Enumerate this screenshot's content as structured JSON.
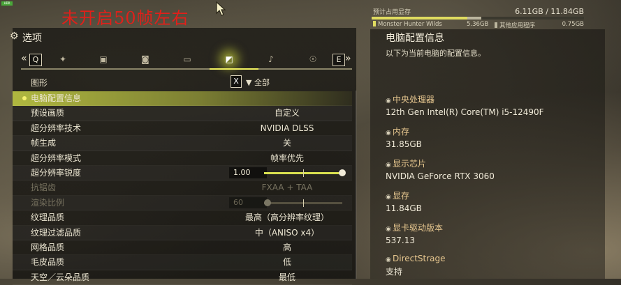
{
  "overlay": {
    "badge": "HDR",
    "note": "未开启50帧左右"
  },
  "vram": {
    "label": "预计占用显存",
    "total": "6.11GB / 11.84GB",
    "used_fraction": 0.452,
    "other_fraction": 0.064,
    "game_name": "Monster Hunter Wilds",
    "game_size": "5.36GB",
    "other_name": "其他应用程序",
    "other_size": "0.75GB",
    "colors": {
      "game": "#e0dc60",
      "other": "#bbb59e"
    }
  },
  "header": {
    "title": "选项",
    "icon": "gear-icon"
  },
  "tabs": {
    "prev_key": "Q",
    "next_key": "E",
    "icons": [
      "hunter-icon",
      "gamepad-icon",
      "camera-icon",
      "display-icon",
      "graphics-icon",
      "sound-icon",
      "accessibility-icon"
    ],
    "active_index": 4
  },
  "section": {
    "label": "图形",
    "filter_key": "X",
    "filter_label": "全部"
  },
  "settings": [
    {
      "name": "电脑配置信息",
      "value": "",
      "selected": true
    },
    {
      "name": "预设画质",
      "value": "自定义"
    },
    {
      "name": "超分辨率技术",
      "value": "NVIDIA DLSS"
    },
    {
      "name": "帧生成",
      "value": "关"
    },
    {
      "name": "超分辨率模式",
      "value": "帧率优先"
    },
    {
      "name": "超分辨率锐度",
      "value": "1.00",
      "slider": 1.0
    },
    {
      "name": "抗锯齿",
      "value": "FXAA + TAA",
      "disabled": true
    },
    {
      "name": "渲染比例",
      "value": "60",
      "slider": 0.0,
      "disabled": true
    },
    {
      "name": "纹理品质",
      "value": "最高（高分辨率纹理）"
    },
    {
      "name": "纹理过滤品质",
      "value": "中（ANISO x4）"
    },
    {
      "name": "网格品质",
      "value": "高"
    },
    {
      "name": "毛皮品质",
      "value": "低"
    },
    {
      "name": "天空／云朵品质",
      "value": "最低"
    }
  ],
  "info": {
    "title": "电脑配置信息",
    "description": "以下为当前电脑的配置信息。",
    "groups": [
      {
        "heading": "中央处理器",
        "value": "12th Gen Intel(R) Core(TM) i5-12490F"
      },
      {
        "heading": "内存",
        "value": "31.85GB"
      },
      {
        "heading": "显示芯片",
        "value": "NVIDIA GeForce RTX 3060"
      },
      {
        "heading": "显存",
        "value": "11.84GB"
      },
      {
        "heading": "显卡驱动版本",
        "value": "537.13"
      },
      {
        "heading": "DirectStrage",
        "value": "支持"
      }
    ]
  }
}
